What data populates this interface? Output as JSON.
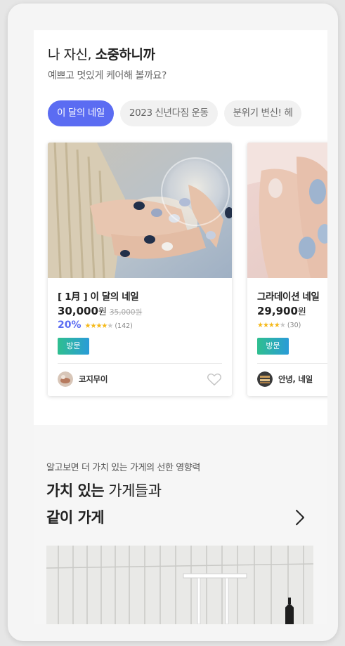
{
  "header": {
    "title_plain": "나 자신, ",
    "title_bold": "소중하니까",
    "subtitle": "예쁘고 멋있게 케어해 볼까요?"
  },
  "chips": [
    {
      "label": "이 달의 네일",
      "active": true
    },
    {
      "label": "2023 신년다짐 운동",
      "active": false
    },
    {
      "label": "분위기 변신! 헤",
      "active": false
    }
  ],
  "products": [
    {
      "title": "[ 1月 ] 이 달의 네일",
      "price": "30,000",
      "won": "원",
      "original_price": "35,000원",
      "discount": "20%",
      "stars_filled": "★★★★",
      "stars_empty": "★",
      "reviews": "(142)",
      "badge": "방문",
      "shop": "코지무이"
    },
    {
      "title": "그라데이션 네일",
      "price": "29,900",
      "won": "원",
      "stars_filled": "★★★★",
      "stars_empty": "★",
      "reviews": "(30)",
      "badge": "방문",
      "shop": "안녕, 네일"
    }
  ],
  "value_section": {
    "subtitle": "알고보면 더 가치 있는 가게의 선한 영향력",
    "title_bold": "가치 있는",
    "title_plain": " 가게들과",
    "title_line2": "같이 가게"
  },
  "icons": {
    "heart": "heart-outline-icon",
    "chevron": "chevron-right-icon"
  },
  "colors": {
    "accent": "#5b6cf2",
    "star": "#f5b91a",
    "badge_start": "#2fbf8f",
    "badge_end": "#2a9bd8"
  }
}
